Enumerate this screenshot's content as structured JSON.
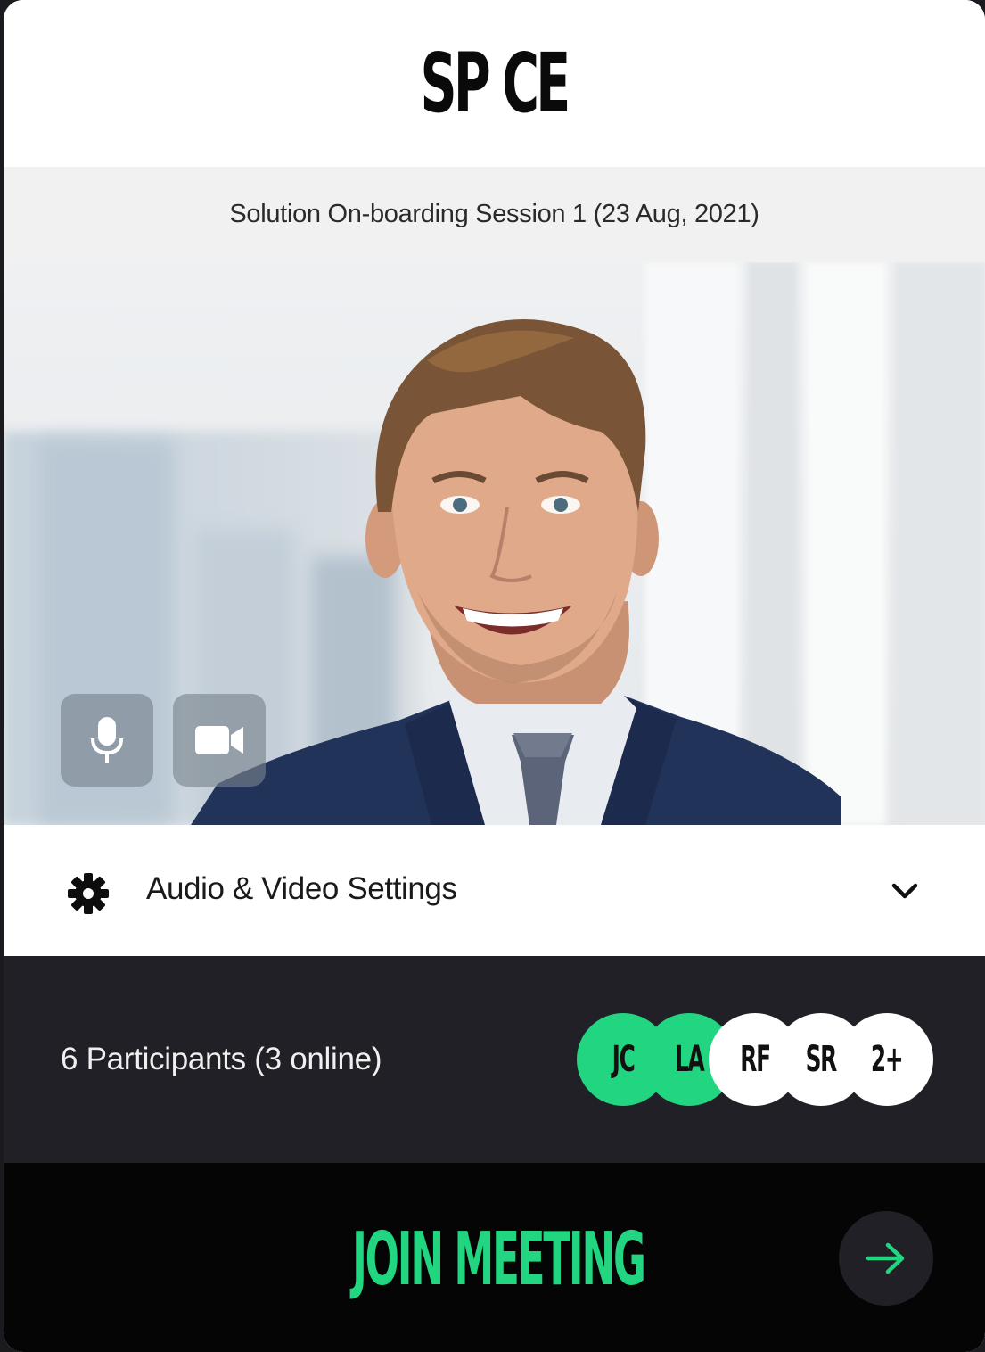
{
  "brand": {
    "logo_text": "SP CE"
  },
  "session": {
    "title": "Solution On-boarding Session 1 (23 Aug, 2021)"
  },
  "video_preview": {
    "controls": [
      {
        "name": "microphone",
        "icon": "microphone-icon"
      },
      {
        "name": "camera",
        "icon": "video-camera-icon"
      }
    ]
  },
  "settings": {
    "label": "Audio & Video Settings",
    "icon": "gear-icon",
    "expand_icon": "chevron-down-icon"
  },
  "participants": {
    "summary": "6 Participants (3 online)",
    "avatars": [
      {
        "initials": "JC",
        "online": true
      },
      {
        "initials": "LA",
        "online": true
      },
      {
        "initials": "RF",
        "online": false
      },
      {
        "initials": "SR",
        "online": false
      },
      {
        "initials": "2+",
        "online": false
      }
    ]
  },
  "join": {
    "label": "JOIN MEETING",
    "icon": "arrow-right-icon"
  },
  "colors": {
    "accent": "#22d581",
    "dark_panel": "#222027",
    "join_bar": "#050505"
  }
}
